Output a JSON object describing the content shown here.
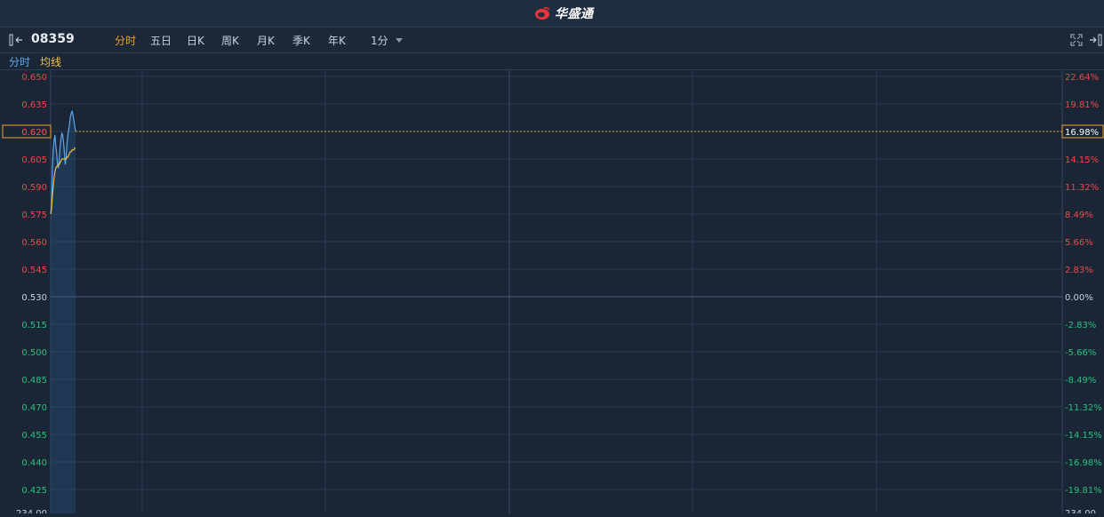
{
  "brand": {
    "name": "华盛通",
    "color": "#e8353a"
  },
  "stock": {
    "code": "08359"
  },
  "tabs": [
    {
      "label": "分时",
      "active": true
    },
    {
      "label": "五日",
      "active": false
    },
    {
      "label": "日K",
      "active": false
    },
    {
      "label": "周K",
      "active": false
    },
    {
      "label": "月K",
      "active": false
    },
    {
      "label": "季K",
      "active": false
    },
    {
      "label": "年K",
      "active": false
    },
    {
      "label": "1分",
      "active": false
    }
  ],
  "legend": {
    "price_label": "分时",
    "avg_label": "均线"
  },
  "colors": {
    "up": "#f04848",
    "down": "#26c27a",
    "neutral": "#c8d2de",
    "price_line": "#5aa8f0",
    "avg_line": "#f0c040",
    "current_price": "#f0a030"
  },
  "chart_data": {
    "type": "line",
    "ylim": [
      0.4175,
      0.6525
    ],
    "base_price": 0.53,
    "current_price": "0.620",
    "current_pct": "16.98%",
    "left_ticks": [
      "0.650",
      "0.635",
      "0.620",
      "0.605",
      "0.590",
      "0.575",
      "0.560",
      "0.545",
      "0.530",
      "0.515",
      "0.500",
      "0.485",
      "0.470",
      "0.455",
      "0.440",
      "0.425"
    ],
    "tick_values": [
      0.65,
      0.635,
      0.62,
      0.605,
      0.59,
      0.575,
      0.56,
      0.545,
      0.53,
      0.515,
      0.5,
      0.485,
      0.47,
      0.455,
      0.44,
      0.425
    ],
    "right_ticks": [
      "22.64%",
      "19.81%",
      "16.98%",
      "14.15%",
      "11.32%",
      "8.49%",
      "5.66%",
      "2.83%",
      "0.00%",
      "-2.83%",
      "-5.66%",
      "-8.49%",
      "-11.32%",
      "-14.15%",
      "-16.98%",
      "-19.81%"
    ],
    "volume_top_label": "234.00",
    "series": [
      {
        "name": "分时",
        "values": [
          0.575,
          0.58,
          0.6,
          0.61,
          0.615,
          0.618,
          0.612,
          0.608,
          0.602,
          0.6,
          0.605,
          0.612,
          0.616,
          0.619,
          0.618,
          0.614,
          0.609,
          0.602,
          0.606,
          0.613,
          0.618,
          0.621,
          0.624,
          0.628,
          0.63,
          0.631,
          0.629,
          0.626,
          0.623,
          0.62
        ]
      },
      {
        "name": "均线",
        "values": [
          0.575,
          0.578,
          0.585,
          0.59,
          0.595,
          0.598,
          0.6,
          0.601,
          0.601,
          0.602,
          0.602,
          0.603,
          0.604,
          0.605,
          0.605,
          0.605,
          0.605,
          0.605,
          0.605,
          0.606,
          0.606,
          0.607,
          0.608,
          0.609,
          0.609,
          0.61,
          0.61,
          0.61,
          0.611,
          0.611
        ]
      }
    ]
  }
}
